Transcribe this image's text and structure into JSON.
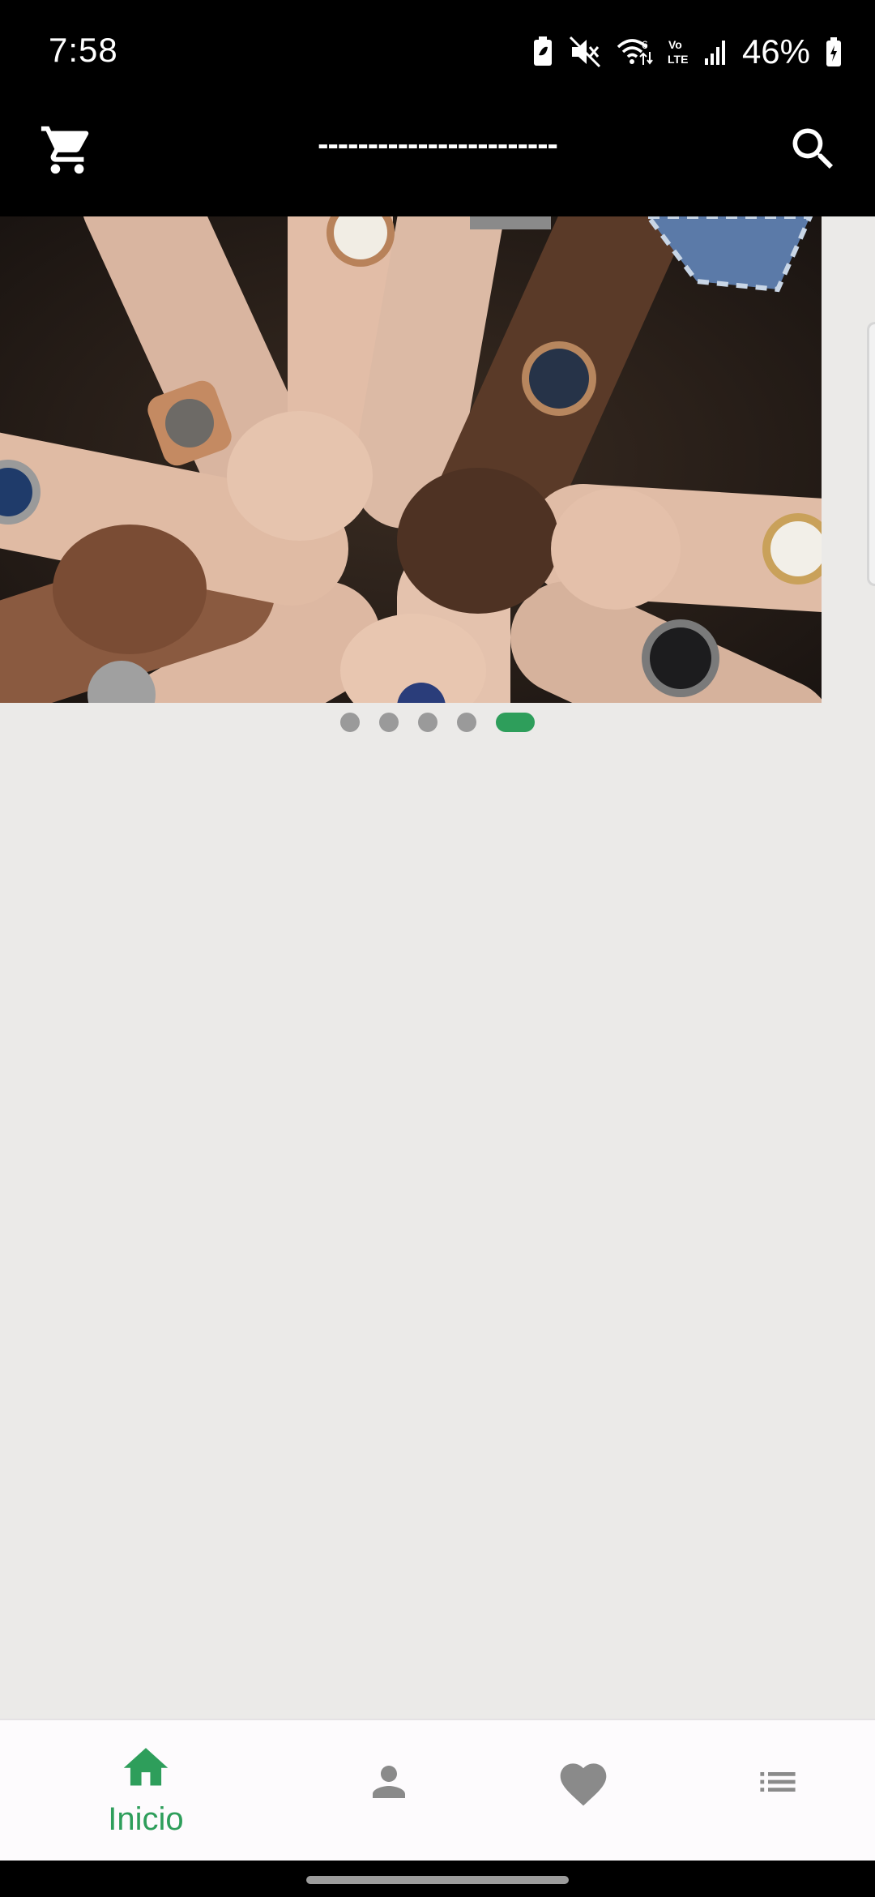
{
  "status_bar": {
    "time": "7:58",
    "battery_percent": "46%",
    "icons": [
      "battery-saver-icon",
      "mute-icon",
      "wifi-icon",
      "volte-icon",
      "signal-icon",
      "battery-icon"
    ]
  },
  "header": {
    "title": "------------------------",
    "left_icon": "cart-icon",
    "right_icon": "search-icon"
  },
  "carousel": {
    "slide_count": 5,
    "active_index": 4,
    "active_color": "#2e9e5b",
    "inactive_color": "#9a9a9a"
  },
  "bottom_nav": {
    "items": [
      {
        "icon": "home-icon",
        "label": "Inicio",
        "active": true
      },
      {
        "icon": "profile-icon",
        "label": "",
        "active": false
      },
      {
        "icon": "heart-icon",
        "label": "",
        "active": false
      },
      {
        "icon": "list-icon",
        "label": "",
        "active": false
      }
    ],
    "active_color": "#2e9e5b",
    "inactive_color": "#8a8a8a"
  }
}
